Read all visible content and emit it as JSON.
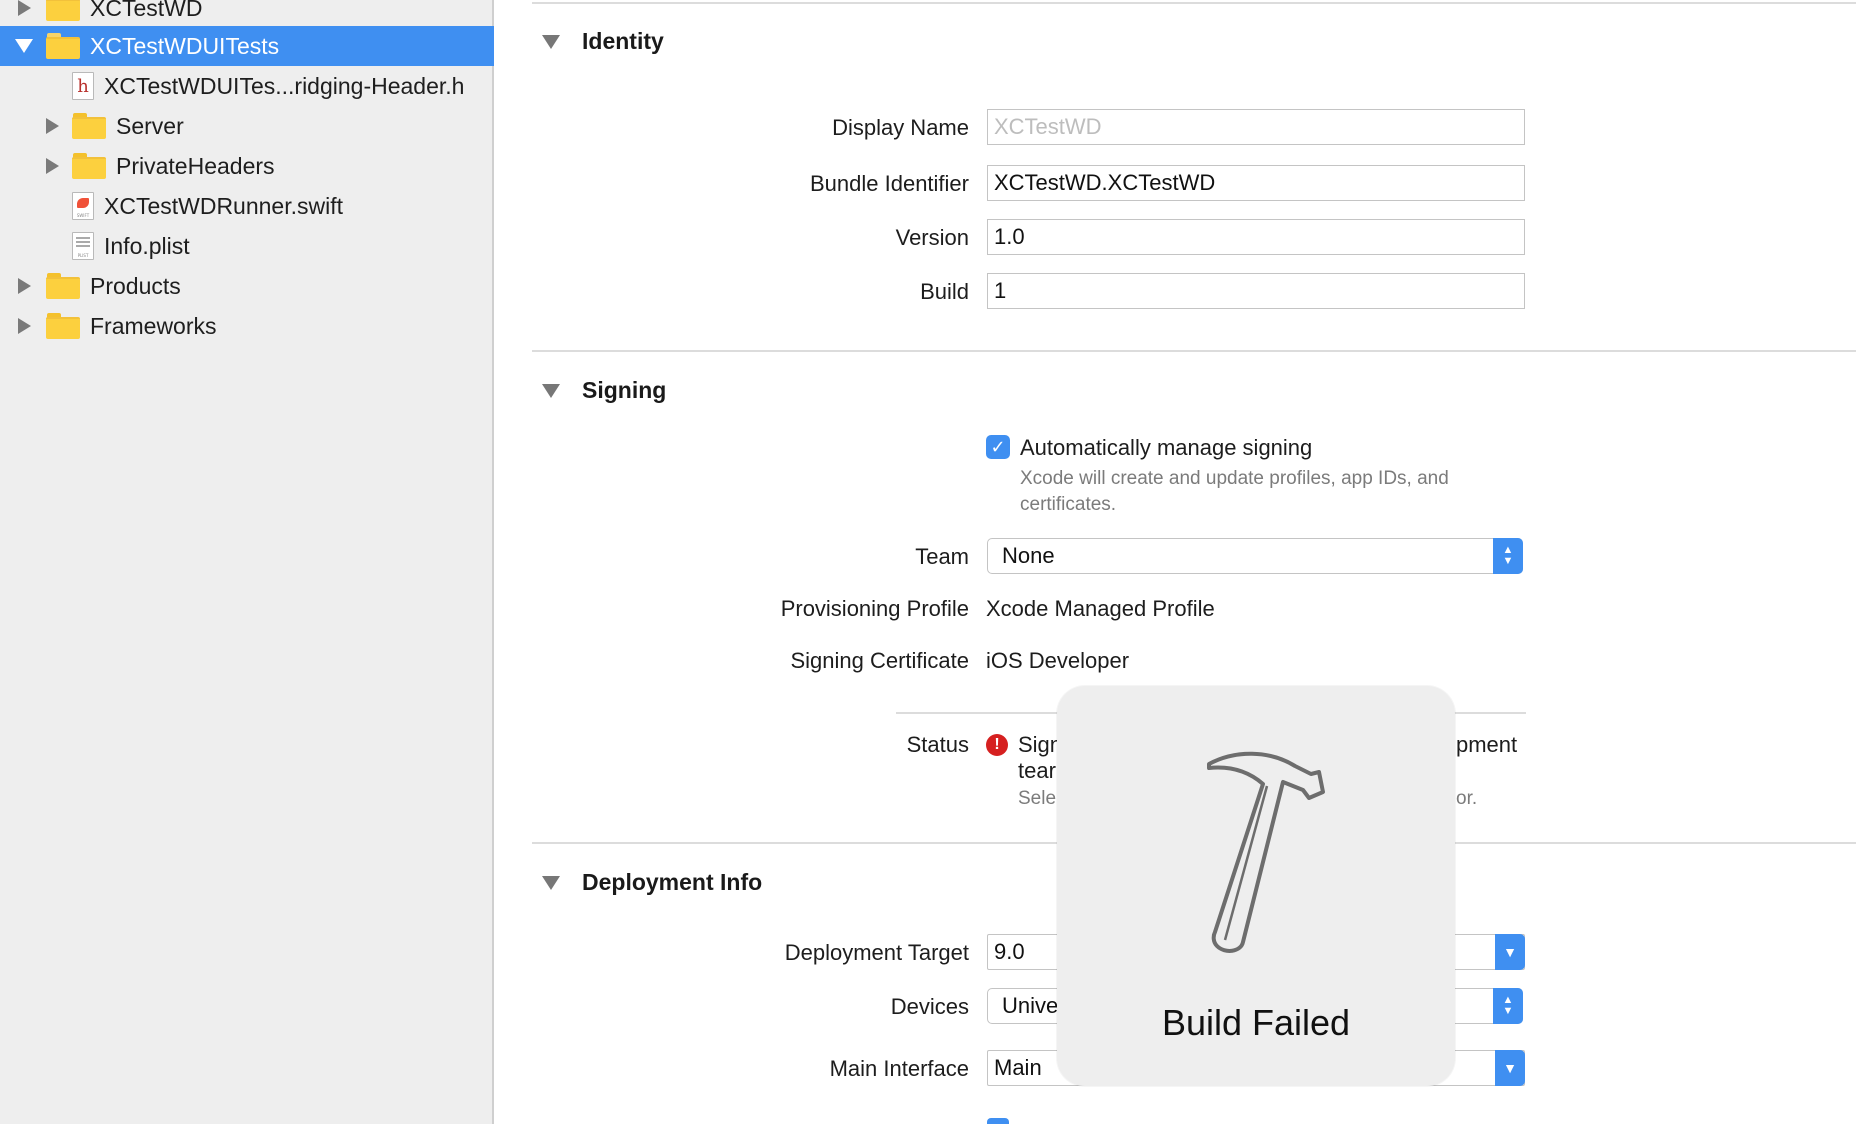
{
  "sidebar": {
    "items": [
      {
        "label": "XCTestWD",
        "type": "folder",
        "expanded": false
      },
      {
        "label": "XCTestWDUITests",
        "type": "folder",
        "expanded": true,
        "selected": true
      },
      {
        "label": "XCTestWDUITes...ridging-Header.h",
        "type": "file",
        "icon": "header-file-icon"
      },
      {
        "label": "Server",
        "type": "folder",
        "expanded": false
      },
      {
        "label": "PrivateHeaders",
        "type": "folder",
        "expanded": false
      },
      {
        "label": "XCTestWDRunner.swift",
        "type": "file",
        "icon": "swift-file-icon"
      },
      {
        "label": "Info.plist",
        "type": "file",
        "icon": "plist-file-icon"
      },
      {
        "label": "Products",
        "type": "folder",
        "expanded": false
      },
      {
        "label": "Frameworks",
        "type": "folder",
        "expanded": false
      }
    ]
  },
  "identity": {
    "heading": "Identity",
    "display_name_label": "Display Name",
    "display_name_value": "XCTestWD",
    "bundle_identifier_label": "Bundle Identifier",
    "bundle_identifier_value": "XCTestWD.XCTestWD",
    "version_label": "Version",
    "version_value": "1.0",
    "build_label": "Build",
    "build_value": "1"
  },
  "signing": {
    "heading": "Signing",
    "auto_manage_label": "Automatically manage signing",
    "auto_manage_checked": true,
    "auto_manage_help_line1": "Xcode will create and update profiles, app IDs, and",
    "auto_manage_help_line2": "certificates.",
    "team_label": "Team",
    "team_value": "None",
    "profile_label": "Provisioning Profile",
    "profile_value": "Xcode Managed Profile",
    "certificate_label": "Signing Certificate",
    "certificate_value": "iOS Developer",
    "status_label": "Status",
    "status_line1_start": "Sign",
    "status_line1_end": "pment",
    "status_line2_start": "tear",
    "status_line3_start": "Sele",
    "status_line3_end": "or."
  },
  "deployment": {
    "heading": "Deployment Info",
    "target_label": "Deployment Target",
    "target_value": "9.0",
    "devices_label": "Devices",
    "devices_value": "Unive",
    "main_interface_label": "Main Interface",
    "main_interface_value": "Main"
  },
  "hud": {
    "title": "Build Failed",
    "icon": "hammer-icon"
  },
  "colors": {
    "selection": "#3f8ff1",
    "folder": "#fcd03e",
    "error": "#d62020"
  }
}
